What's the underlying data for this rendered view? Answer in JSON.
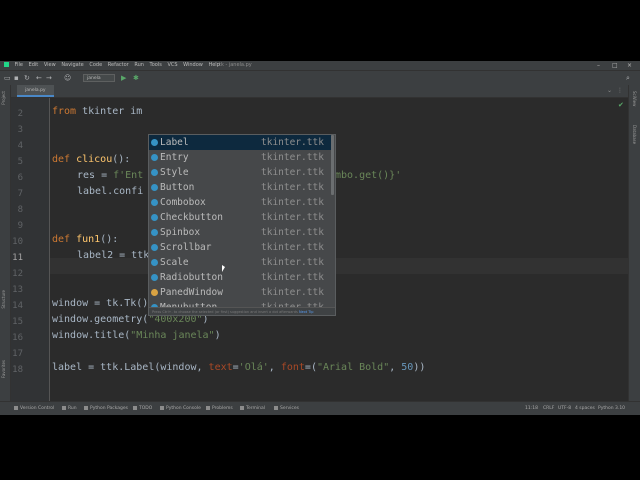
{
  "menu": [
    "File",
    "Edit",
    "View",
    "Navigate",
    "Code",
    "Refactor",
    "Run",
    "Tools",
    "VCS",
    "Window",
    "Help"
  ],
  "window_title": "tk - janela.py",
  "window_controls": {
    "minimize": "–",
    "maximize": "□",
    "close": "×"
  },
  "toolbar": {
    "run_config": "janela",
    "run_icon": "play-icon",
    "debug_icon": "bug-icon"
  },
  "left_strip": {
    "project": "Project",
    "structure": "Structure",
    "favorites": "Favorites"
  },
  "right_strip": {
    "scview": "SciView",
    "database": "Database"
  },
  "tab": {
    "label": "janela.py"
  },
  "editor": {
    "line_numbers": [
      "2",
      "3",
      "4",
      "5",
      "6",
      "7",
      "8",
      "9",
      "10",
      "11",
      "12",
      "13",
      "14",
      "15",
      "16",
      "17",
      "18"
    ],
    "current_line": "11",
    "line2_visible_start": "from tkinter im",
    "line6_res": "res = f'Ent",
    "line6_tail": "mbo.get()}'",
    "line7": "label.confi",
    "line10_def": "def",
    "line10_name": "fun1",
    "line10_rest": "():",
    "line11": "label2 = ttk.",
    "line5_def": "def",
    "line5_name": "clicou",
    "line5_rest": "():",
    "line14": "window = tk.Tk()",
    "line15_a": "window.geometry(",
    "line15_str": "\"400x200\"",
    "line15_b": ")",
    "line16_a": "window.title(",
    "line16_str": "\"Minha janela\"",
    "line16_b": ")",
    "line18_a": "label = ttk.Label(window, ",
    "line18_p1": "text",
    "line18_eq": "=",
    "line18_s1": "'Olá'",
    "line18_c": ", ",
    "line18_p2": "font",
    "line18_eq2": "=(",
    "line18_s2": "\"Arial Bold\"",
    "line18_c2": ", ",
    "line18_n": "50",
    "line18_end": "))"
  },
  "autocomplete": {
    "items": [
      {
        "name": "Label",
        "module": "tkinter.ttk",
        "kind": "class"
      },
      {
        "name": "Entry",
        "module": "tkinter.ttk",
        "kind": "class"
      },
      {
        "name": "Style",
        "module": "tkinter.ttk",
        "kind": "class"
      },
      {
        "name": "Button",
        "module": "tkinter.ttk",
        "kind": "class"
      },
      {
        "name": "Combobox",
        "module": "tkinter.ttk",
        "kind": "class"
      },
      {
        "name": "Checkbutton",
        "module": "tkinter.ttk",
        "kind": "class"
      },
      {
        "name": "Spinbox",
        "module": "tkinter.ttk",
        "kind": "class"
      },
      {
        "name": "Scrollbar",
        "module": "tkinter.ttk",
        "kind": "class"
      },
      {
        "name": "Scale",
        "module": "tkinter.ttk",
        "kind": "class"
      },
      {
        "name": "Radiobutton",
        "module": "tkinter.ttk",
        "kind": "class"
      },
      {
        "name": "PanedWindow",
        "module": "tkinter.ttk",
        "kind": "variable"
      },
      {
        "name": "Menubutton",
        "module": "tkinter.ttk",
        "kind": "class"
      }
    ],
    "selected_index": 0,
    "footer": "Press Ctrl+. to choose the selected (or first) suggestion and insert a dot afterwards",
    "footer_hint": "Next Tip"
  },
  "statusbar": {
    "version_control": "Version Control",
    "run": "Run",
    "todo": "TODO",
    "python_packages": "Python Packages",
    "python_console": "Python Console",
    "problems": "Problems",
    "terminal": "Terminal",
    "services": "Services",
    "position": "11:18",
    "line_sep": "CRLF",
    "encoding": "UTF-8",
    "indent": "4 spaces",
    "interpreter": "Python 3.10"
  }
}
